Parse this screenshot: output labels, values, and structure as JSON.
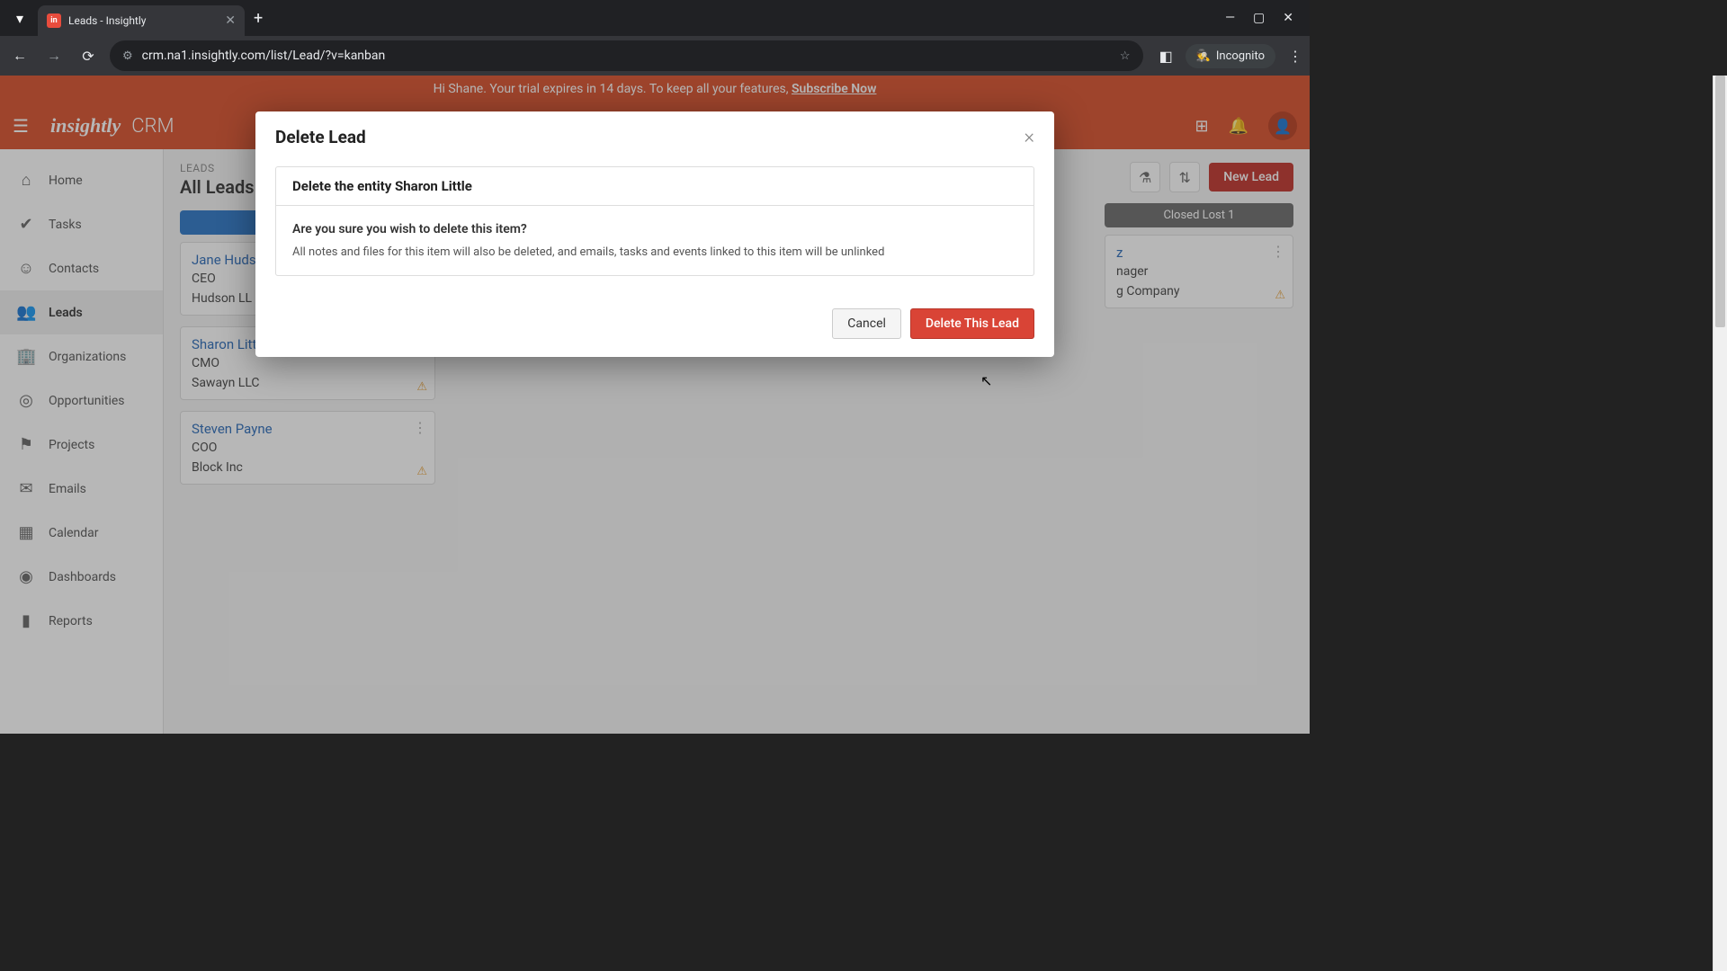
{
  "browser": {
    "tab_title": "Leads - Insightly",
    "url": "crm.na1.insightly.com/list/Lead/?v=kanban",
    "incognito_label": "Incognito"
  },
  "trial": {
    "greeting": "Hi Shane. Your trial expires in 14 days. To keep all your features, ",
    "link": "Subscribe Now"
  },
  "header": {
    "logo": "insightly",
    "product": "CRM"
  },
  "sidebar": {
    "items": [
      {
        "label": "Home",
        "icon": "⌂"
      },
      {
        "label": "Tasks",
        "icon": "✔"
      },
      {
        "label": "Contacts",
        "icon": "☺"
      },
      {
        "label": "Leads",
        "icon": "👥"
      },
      {
        "label": "Organizations",
        "icon": "🏢"
      },
      {
        "label": "Opportunities",
        "icon": "◎"
      },
      {
        "label": "Projects",
        "icon": "⚑"
      },
      {
        "label": "Emails",
        "icon": "✉"
      },
      {
        "label": "Calendar",
        "icon": "▦"
      },
      {
        "label": "Dashboards",
        "icon": "◉"
      },
      {
        "label": "Reports",
        "icon": "▮"
      }
    ]
  },
  "page": {
    "crumb": "LEADS",
    "title": "All Leads",
    "new_button": "New Lead"
  },
  "columns": {
    "closed_lost": "Closed Lost 1"
  },
  "cards": [
    {
      "name": "Jane Hudson",
      "role": "CEO",
      "company": "Hudson LL"
    },
    {
      "name": "Sharon Little",
      "role": "CMO",
      "company": "Sawayn LLC"
    },
    {
      "name": "Steven Payne",
      "role": "COO",
      "company": "Block Inc"
    }
  ],
  "right_card": {
    "name_partial": "z",
    "role_partial": "nager",
    "company_partial": "g Company"
  },
  "modal": {
    "title": "Delete Lead",
    "entity_label": "Delete the entity Sharon Little",
    "confirm_question": "Are you sure you wish to delete this item?",
    "confirm_note": "All notes and files for this item will also be deleted, and emails, tasks and events linked to this item will be unlinked",
    "cancel": "Cancel",
    "delete": "Delete This Lead"
  }
}
